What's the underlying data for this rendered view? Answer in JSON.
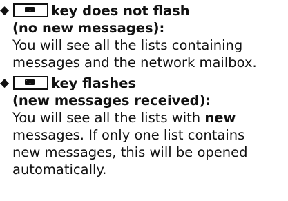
{
  "items": [
    {
      "bullet": "◆",
      "key_icon": "envelope-icon",
      "heading_line1": "key does not flash",
      "heading_line2": "(no new messages):",
      "body_line1": "You will see all the lists containing",
      "body_line2": "messages and the network mailbox."
    },
    {
      "bullet": "◆",
      "key_icon": "envelope-icon",
      "heading_line1": "key flashes",
      "heading_line2": "(new messages received):",
      "body_line1_pre": "You will see all the lists with ",
      "body_line1_bold": "new",
      "body_line2": "messages. If only one list contains",
      "body_line3": "new messages, this will be opened",
      "body_line4": "automatically."
    }
  ]
}
